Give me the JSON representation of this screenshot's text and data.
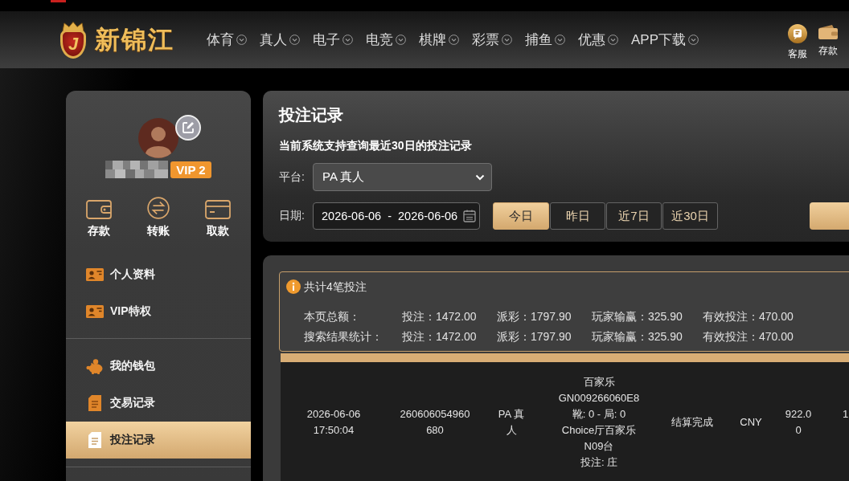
{
  "header": {
    "logo": {
      "emblem_letter": "J",
      "name": "新锦江"
    },
    "nav": [
      {
        "label": "体育"
      },
      {
        "label": "真人"
      },
      {
        "label": "电子"
      },
      {
        "label": "电竞"
      },
      {
        "label": "棋牌"
      },
      {
        "label": "彩票"
      },
      {
        "label": "捕鱼"
      },
      {
        "label": "优惠"
      },
      {
        "label": "APP下载"
      }
    ],
    "quick_links": [
      {
        "kind": "support",
        "label": "客服"
      },
      {
        "kind": "wallet",
        "label": "存款"
      }
    ]
  },
  "sidebar": {
    "profile": {
      "vip": "VIP 2"
    },
    "actions": [
      {
        "kind": "wallet",
        "label": "存款"
      },
      {
        "kind": "transfer",
        "label": "转账"
      },
      {
        "kind": "card",
        "label": "取款"
      }
    ],
    "menu_sections": [
      {
        "items": [
          {
            "kind": "id-card",
            "label": "个人资料",
            "selected": false
          },
          {
            "kind": "id-card",
            "label": "VIP特权",
            "selected": false
          }
        ]
      },
      {
        "items": [
          {
            "kind": "piggy-bank",
            "label": "我的钱包",
            "selected": false
          },
          {
            "kind": "document",
            "label": "交易记录",
            "selected": false
          },
          {
            "kind": "document",
            "label": "投注记录",
            "selected": true
          }
        ]
      }
    ]
  },
  "filters": {
    "title": "投注记录",
    "note": "当前系统支持查询最近30日的投注记录",
    "platform": {
      "label": "平台:",
      "value": "PA 真人"
    },
    "date": {
      "label": "日期:",
      "from": "2026-06-06",
      "separator": "-",
      "to": "2026-06-06"
    },
    "ranges": [
      {
        "label": "今日",
        "selected": true
      },
      {
        "label": "昨日",
        "selected": false
      },
      {
        "label": "近7日",
        "selected": false
      },
      {
        "label": "近30日",
        "selected": false
      }
    ]
  },
  "results": {
    "count": "共计4笔投注",
    "totals": [
      {
        "label": "本页总额：",
        "values": [
          "投注：1472.00",
          "派彩：1797.90",
          "玩家输赢：325.90",
          "有效投注：470.00"
        ]
      },
      {
        "label": "搜索结果统计：",
        "values": [
          "投注：1472.00",
          "派彩：1797.90",
          "玩家输赢：325.90",
          "有效投注：470.00"
        ]
      }
    ],
    "table": {
      "rows": [
        {
          "time": "2026-06-06 17:50:04",
          "order_no": "260606054960680",
          "platform": "PA 真人",
          "details": [
            "百家乐",
            "GN009266060E8",
            "靴: 0 - 局: 0",
            "Choice厅百家乐",
            "N09台",
            "投注: 庄"
          ],
          "status": "结算完成",
          "currency": "CNY",
          "amount": "922.00",
          "column_8": "1"
        }
      ]
    }
  }
}
